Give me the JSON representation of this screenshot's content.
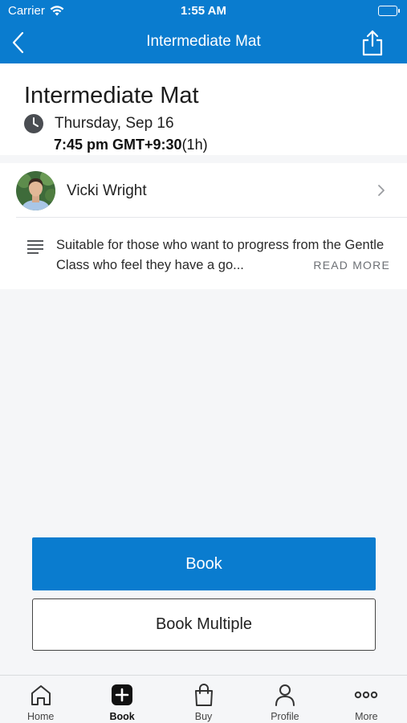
{
  "status_bar": {
    "carrier": "Carrier",
    "time": "1:55 AM"
  },
  "nav": {
    "title": "Intermediate Mat",
    "back_icon": "chevron-left-icon",
    "share_icon": "share-icon"
  },
  "class": {
    "title": "Intermediate Mat",
    "date": "Thursday, Sep 16",
    "time": "7:45 pm GMT+9:30",
    "duration": "(1h)"
  },
  "instructor": {
    "name": "Vicki Wright"
  },
  "description": {
    "text": "Suitable for those who want to progress from the Gentle Class who feel they have a go...",
    "read_more": "READ MORE"
  },
  "actions": {
    "book_label": "Book",
    "book_multiple_label": "Book Multiple"
  },
  "tabs": [
    {
      "label": "Home",
      "icon": "home-icon"
    },
    {
      "label": "Book",
      "icon": "plus-square-icon",
      "active": true
    },
    {
      "label": "Buy",
      "icon": "shopping-bag-icon"
    },
    {
      "label": "Profile",
      "icon": "person-icon"
    },
    {
      "label": "More",
      "icon": "more-dots-icon"
    }
  ],
  "colors": {
    "primary": "#0a7ccf",
    "background": "#f5f6f8",
    "card": "#ffffff"
  }
}
